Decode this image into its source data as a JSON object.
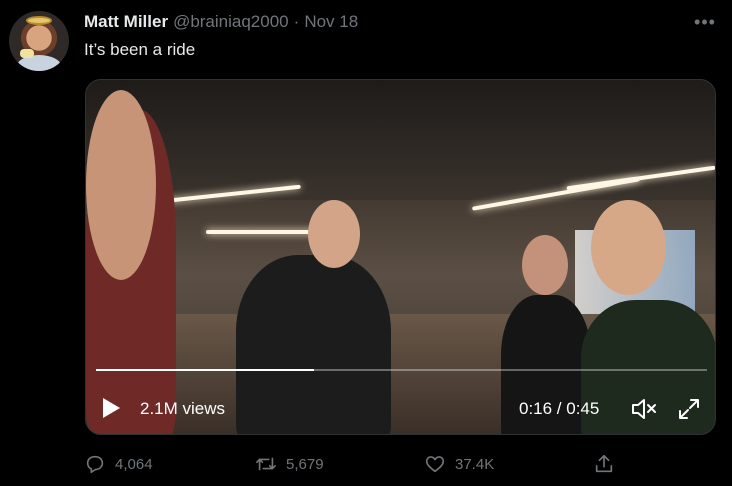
{
  "tweet": {
    "author_name": "Matt Miller",
    "handle": "@brainiaq2000",
    "separator": "·",
    "date": "Nov 18",
    "text": "It’s been a ride"
  },
  "video": {
    "views": "2.1M views",
    "time": "0:16 / 0:45",
    "progress_fraction": 0.356
  },
  "actions": {
    "replies": "4,064",
    "retweets": "5,679",
    "likes": "37.4K"
  },
  "icons": {
    "more": "more-horizontal-icon",
    "play": "play-icon",
    "mute": "volume-muted-icon",
    "fullscreen": "fullscreen-icon",
    "reply": "reply-icon",
    "retweet": "retweet-icon",
    "like": "heart-icon",
    "share": "share-icon"
  },
  "colors": {
    "background": "#000000",
    "muted_text": "#71767b",
    "primary_text": "#e7e9ea"
  }
}
